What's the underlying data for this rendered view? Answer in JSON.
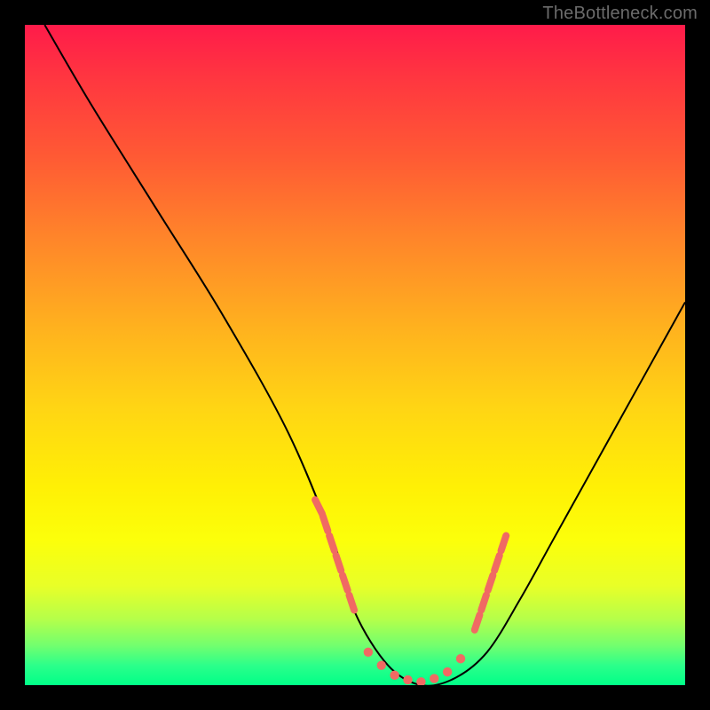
{
  "watermark": "TheBottleneck.com",
  "chart_data": {
    "type": "line",
    "title": "",
    "xlabel": "",
    "ylabel": "",
    "xlim": [
      0,
      100
    ],
    "ylim": [
      0,
      100
    ],
    "grid": false,
    "series": [
      {
        "name": "curve",
        "x": [
          3,
          10,
          20,
          30,
          40,
          47,
          50,
          55,
          60,
          65,
          70,
          75,
          80,
          85,
          90,
          95,
          100
        ],
        "y": [
          100,
          88,
          72,
          56,
          38,
          21,
          11,
          3,
          0,
          1,
          5,
          13,
          22,
          31,
          40,
          49,
          58
        ]
      }
    ],
    "valley_markers": {
      "left": [
        [
          44,
          28
        ],
        [
          45,
          26
        ],
        [
          46,
          23
        ],
        [
          47,
          20
        ],
        [
          48,
          17
        ],
        [
          49,
          14
        ],
        [
          50,
          11
        ]
      ],
      "floor": [
        [
          52,
          5
        ],
        [
          54,
          3
        ],
        [
          56,
          1.5
        ],
        [
          58,
          0.8
        ],
        [
          60,
          0.5
        ],
        [
          62,
          1
        ],
        [
          64,
          2
        ],
        [
          66,
          4
        ]
      ],
      "right": [
        [
          68,
          8
        ],
        [
          69,
          11
        ],
        [
          70,
          14
        ],
        [
          71,
          17
        ],
        [
          72,
          20
        ],
        [
          73,
          23
        ]
      ],
      "dash_len": 2.4
    }
  }
}
